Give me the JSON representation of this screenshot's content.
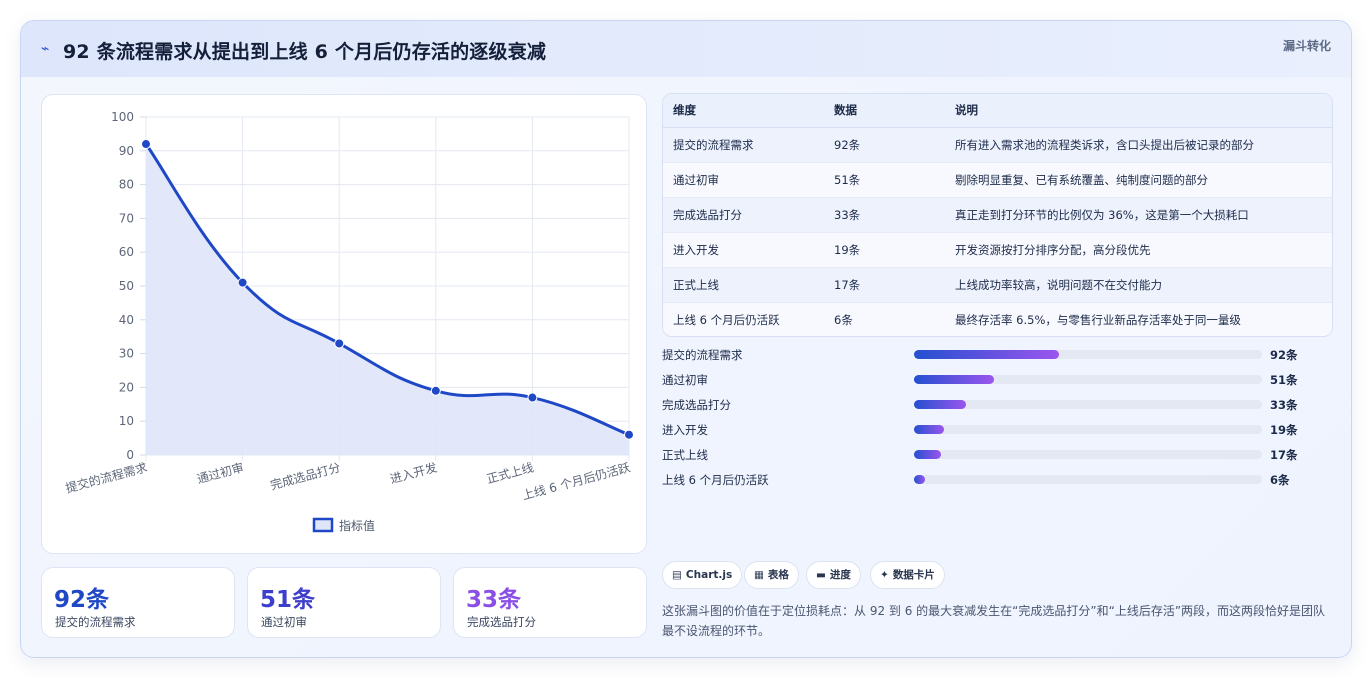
{
  "header": {
    "icon": "pulse-icon",
    "title": "92 条流程需求从提出到上线 6 个月后仍存活的逐级衰减",
    "tag": "漏斗转化"
  },
  "chart_data": {
    "type": "line",
    "categories": [
      "提交的流程需求",
      "通过初审",
      "完成选品打分",
      "进入开发",
      "正式上线",
      "上线 6 个月后仍活跃"
    ],
    "series": [
      {
        "name": "指标值",
        "values": [
          92,
          51,
          33,
          19,
          17,
          6
        ]
      }
    ],
    "ylim": [
      0,
      100
    ],
    "yticks": [
      0,
      10,
      20,
      30,
      40,
      50,
      60,
      70,
      80,
      90,
      100
    ],
    "fill": true,
    "grid": true,
    "legend": "bottom",
    "colors": {
      "line": "#1f48c6",
      "fill": "#dfe6fa"
    }
  },
  "stats": [
    {
      "value": "92条",
      "label": "提交的流程需求",
      "color": "#1f48c6"
    },
    {
      "value": "51条",
      "label": "通过初审",
      "color": "#3d3fcc"
    },
    {
      "value": "33条",
      "label": "完成选品打分",
      "color": "#8a4fe6"
    }
  ],
  "table": {
    "headers": [
      "维度",
      "数据",
      "说明"
    ],
    "rows": [
      [
        "提交的流程需求",
        "92条",
        "所有进入需求池的流程类诉求，含口头提出后被记录的部分"
      ],
      [
        "通过初审",
        "51条",
        "剔除明显重复、已有系统覆盖、纯制度问题的部分"
      ],
      [
        "完成选品打分",
        "33条",
        "真正走到打分环节的比例仅为 36%，这是第一个大损耗口"
      ],
      [
        "进入开发",
        "19条",
        "开发资源按打分排序分配，高分段优先"
      ],
      [
        "正式上线",
        "17条",
        "上线成功率较高，说明问题不在交付能力"
      ],
      [
        "上线 6 个月后仍活跃",
        "6条",
        "最终存活率 6.5%，与零售行业新品存活率处于同一量级"
      ]
    ]
  },
  "progress": [
    {
      "label": "提交的流程需求",
      "value": "92条",
      "fraction": 0.417
    },
    {
      "label": "通过初审",
      "value": "51条",
      "fraction": 0.231
    },
    {
      "label": "完成选品打分",
      "value": "33条",
      "fraction": 0.149
    },
    {
      "label": "进入开发",
      "value": "19条",
      "fraction": 0.086
    },
    {
      "label": "正式上线",
      "value": "17条",
      "fraction": 0.077
    },
    {
      "label": "上线 6 个月后仍活跃",
      "value": "6条",
      "fraction": 0.033
    }
  ],
  "chips": [
    {
      "icon": "chart-icon",
      "glyph": "▤",
      "label": "Chart.js"
    },
    {
      "icon": "table-icon",
      "glyph": "▦",
      "label": "表格"
    },
    {
      "icon": "progress-icon",
      "glyph": "▬",
      "label": "进度"
    },
    {
      "icon": "sparkle-icon",
      "glyph": "✦",
      "label": "数据卡片"
    }
  ],
  "note": "这张漏斗图的价值在于定位损耗点：从 92 到 6 的最大衰减发生在“完成选品打分”和“上线后存活”两段，而这两段恰好是团队最不设流程的环节。"
}
